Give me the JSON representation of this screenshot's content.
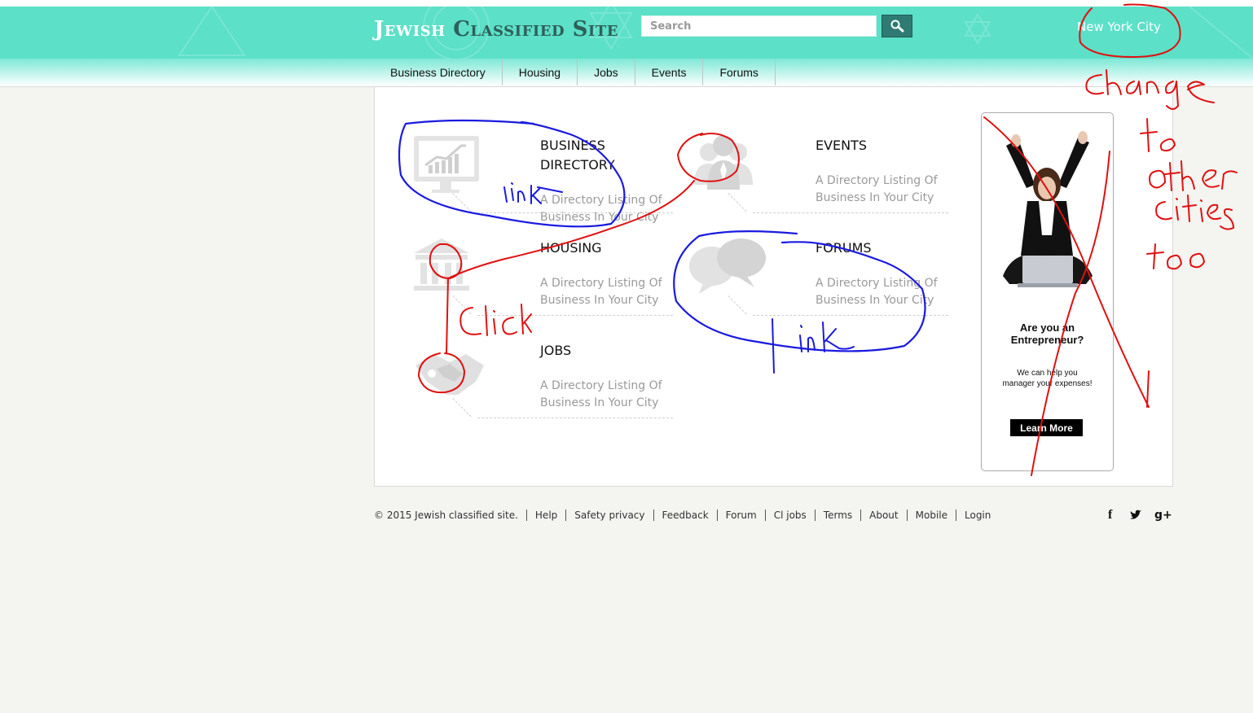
{
  "header": {
    "logo_part1": "Jewish",
    "logo_part2": "Classified Site",
    "search_placeholder": "Search",
    "city": "New York City",
    "accent_color": "#5ce0c8"
  },
  "nav": {
    "items": [
      "Business Directory",
      "Housing",
      "Jobs",
      "Events",
      "Forums"
    ]
  },
  "categories": [
    {
      "title": "BUSINESS DIRECTORY",
      "desc": "A Directory Listing Of Business In Your City",
      "icon": "chart-monitor-icon"
    },
    {
      "title": "EVENTS",
      "desc": "A Directory Listing Of Business In Your City",
      "icon": "people-icon"
    },
    {
      "title": "HOUSING",
      "desc": "A Directory Listing Of Business In Your City",
      "icon": "bank-building-icon"
    },
    {
      "title": "FORUMS",
      "desc": "A Directory Listing Of Business In Your City",
      "icon": "speech-bubbles-icon"
    },
    {
      "title": "JOBS",
      "desc": "A Directory Listing Of Business In Your City",
      "icon": "handshake-icon"
    }
  ],
  "ad": {
    "question_line1": "Are you an",
    "question_line2": "Entrepreneur?",
    "sub_line1": "We can help you",
    "sub_line2": "manager your expenses!",
    "button": "Learn More"
  },
  "footer": {
    "copyright": "© 2015 Jewish classified site.",
    "links": [
      "Help",
      "Safety privacy",
      "Feedback",
      "Forum",
      "Cl jobs",
      "Terms",
      "About",
      "Mobile",
      "Login"
    ],
    "social": [
      "facebook-icon",
      "twitter-icon",
      "google-plus-icon"
    ]
  },
  "annotations": {
    "link_1": "link",
    "link_2": "link",
    "click": "Click",
    "note_line1": "change",
    "note_line2": "to",
    "note_line3": "other",
    "note_line4": "cities",
    "note_line5": "too"
  }
}
